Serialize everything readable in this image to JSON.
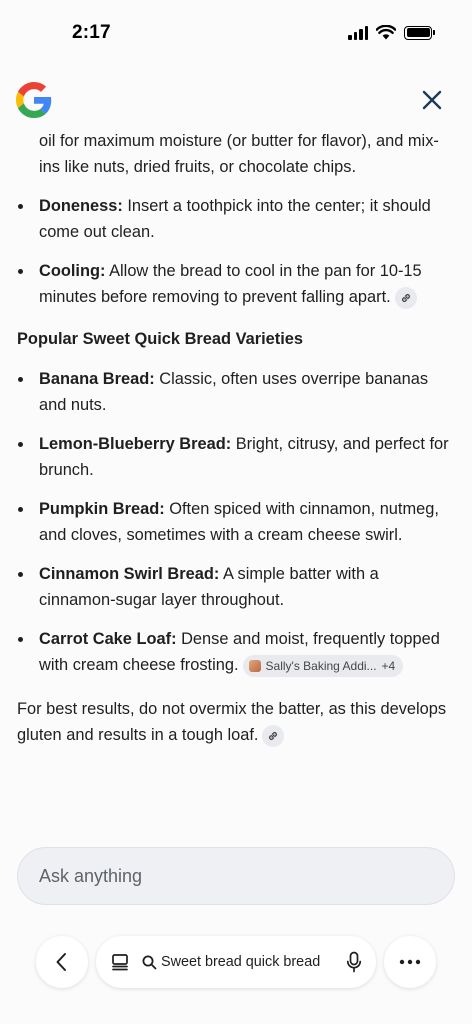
{
  "status": {
    "time": "2:17"
  },
  "content": {
    "partial_text": "oil for maximum moisture (or butter for flavor), and mix-ins like nuts, dried fruits, or chocolate chips.",
    "tips": [
      {
        "term": "Doneness:",
        "text": " Insert a toothpick into the center; it should come out clean."
      },
      {
        "term": "Cooling:",
        "text": " Allow the bread to cool in the pan for 10-15 minutes before removing to prevent falling apart."
      }
    ],
    "section_title": "Popular Sweet Quick Bread Varieties",
    "varieties": [
      {
        "term": "Banana Bread:",
        "text": " Classic, often uses overripe bananas and nuts."
      },
      {
        "term": "Lemon-Blueberry Bread:",
        "text": " Bright, citrusy, and perfect for brunch."
      },
      {
        "term": "Pumpkin Bread:",
        "text": " Often spiced with cinnamon, nutmeg, and cloves, sometimes with a cream cheese swirl."
      },
      {
        "term": "Cinnamon Swirl Bread:",
        "text": " A simple batter with a cinnamon-sugar layer throughout."
      },
      {
        "term": "Carrot Cake Loaf:",
        "text": " Dense and moist, frequently topped with cream cheese frosting."
      }
    ],
    "source_chip": {
      "label": "Sally's Baking Addi...",
      "count": "+4"
    },
    "closing": "For best results, do not overmix the batter, as this develops gluten and results in a tough loaf."
  },
  "ask": {
    "placeholder": "Ask anything"
  },
  "nav": {
    "query": "Sweet bread quick bread"
  },
  "icons": {
    "logo": "google-g-logo",
    "close": "close-icon",
    "link": "link-icon",
    "back": "chevron-left-icon",
    "tabs": "tabs-icon",
    "search": "search-icon",
    "mic": "mic-icon",
    "more": "more-horizontal-icon"
  },
  "colors": {
    "background": "#fbfbfc",
    "ask_bar": "#eef0f3",
    "chip": "#e9eaee",
    "close_icon": "#1a3a5f"
  }
}
